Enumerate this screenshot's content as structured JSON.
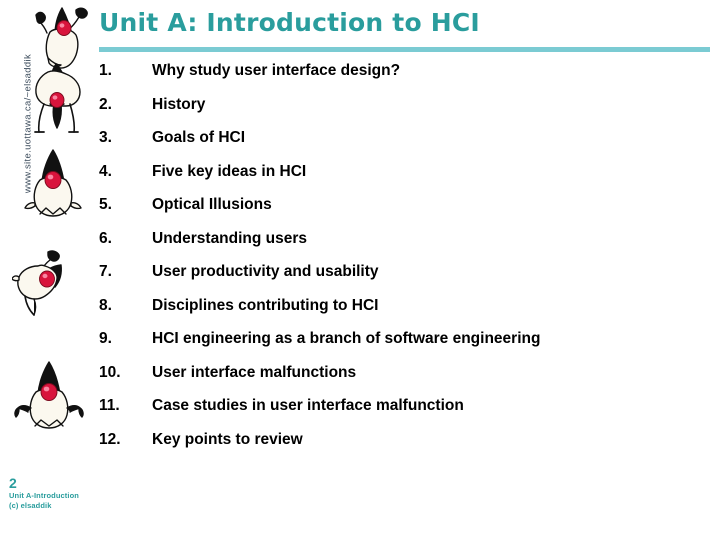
{
  "slide": {
    "title": "Unit  A: Introduction to HCI",
    "title_color": "#2a9d9d",
    "rule_color": "#7bcbd3",
    "background_color": "#ffffff"
  },
  "sidebar": {
    "vertical_url": "www.site.uottawa.ca/~elsaddik",
    "vertical_url_color": "#3a4a5a",
    "mascots": [
      {
        "name": "duke-mascot-1",
        "pose": "arms-up-leaning-right"
      },
      {
        "name": "duke-mascot-2",
        "pose": "standing-legs-apart"
      },
      {
        "name": "duke-mascot-3",
        "pose": "upright-pointed-cap"
      },
      {
        "name": "duke-mascot-4",
        "pose": "leaning-left"
      },
      {
        "name": "duke-mascot-5",
        "pose": "arms-out-wide"
      }
    ],
    "mascot_body_color": "#fbf8ef",
    "mascot_cap_color": "#1a1a1a",
    "mascot_nose_color": "#d8143c"
  },
  "agenda": {
    "items": [
      {
        "number": "1.",
        "label": "Why study user interface design?"
      },
      {
        "number": "2.",
        "label": "History"
      },
      {
        "number": "3.",
        "label": "Goals of HCI"
      },
      {
        "number": "4.",
        "label": "Five key ideas in HCI"
      },
      {
        "number": "5.",
        "label": "Optical Illusions"
      },
      {
        "number": "6.",
        "label": "Understanding users"
      },
      {
        "number": "7.",
        "label": "User productivity and usability"
      },
      {
        "number": "8.",
        "label": "Disciplines contributing to HCI"
      },
      {
        "number": "9.",
        "label": "HCI engineering as a branch of software engineering"
      },
      {
        "number": "10.",
        "label": "User interface malfunctions"
      },
      {
        "number": "11.",
        "label": "Case studies in user interface malfunction"
      },
      {
        "number": "12.",
        "label": "Key points to review"
      }
    ]
  },
  "footer": {
    "page_number": "2",
    "line1": "Unit A-Introduction",
    "line2": "(c) elsaddik",
    "color": "#2a9d9d"
  }
}
